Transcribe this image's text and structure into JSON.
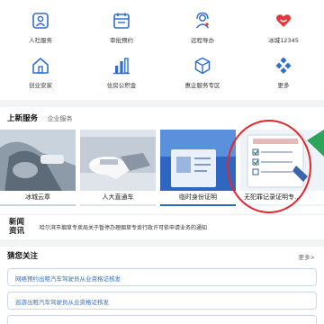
{
  "services": [
    {
      "label": "人社服务",
      "icon": "person-id-icon"
    },
    {
      "label": "审批预约",
      "icon": "calendar-icon"
    },
    {
      "label": "远程导办",
      "icon": "headset-person-icon"
    },
    {
      "label": "冰城12345",
      "icon": "hotline-heart-icon"
    },
    {
      "label": "创业安家",
      "icon": "home-icon"
    },
    {
      "label": "住房公积金",
      "icon": "building-chart-icon"
    },
    {
      "label": "惠企服务专区",
      "icon": "cube-icon"
    },
    {
      "label": "更多",
      "icon": "more-grid-icon"
    }
  ],
  "new_services": {
    "title": "上新服务",
    "subtitle": "企业服务",
    "cards": [
      {
        "label": "冰城云章"
      },
      {
        "label": "人大直通车"
      },
      {
        "label": "临时身份证明"
      },
      {
        "label": "无犯罪记录证明专..."
      }
    ]
  },
  "news": {
    "badge_line1": "新闻",
    "badge_line2": "资讯",
    "headline": "哈尔滨市烟草专卖局关于暂停办理烟草专卖行政许可依申请业务的通知"
  },
  "guess": {
    "title": "猜您关注",
    "more": "更多>",
    "items": [
      {
        "label": "网络预约出租汽车驾驶员从业资格证核发"
      },
      {
        "label": "巡游出租汽车驾驶员从业资格证核发"
      }
    ]
  },
  "colors": {
    "icon_blue": "#2f6fd0",
    "heart_red": "#e03b3b",
    "accent_red": "#e3262b",
    "link_blue": "#3b6fb6"
  }
}
